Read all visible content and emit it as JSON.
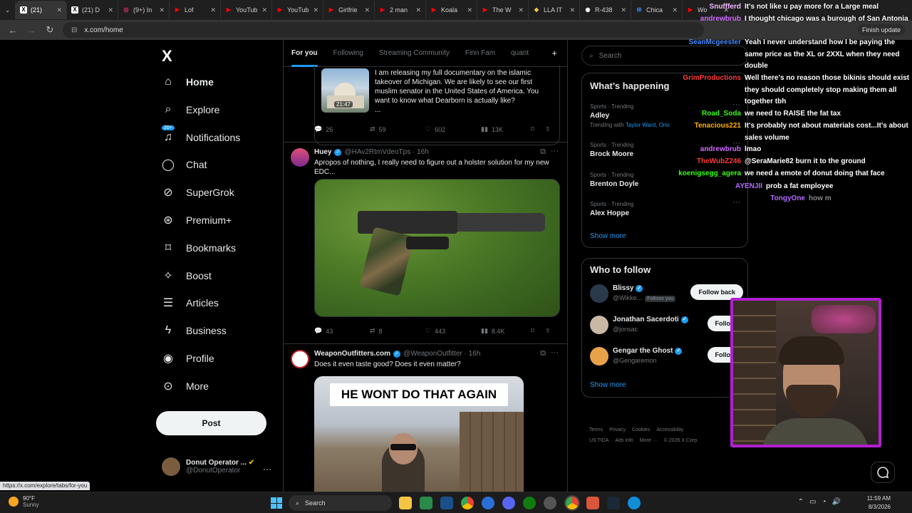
{
  "browser": {
    "tabs": [
      {
        "label": "(21)",
        "fav": "X",
        "color": "#000000",
        "active": true
      },
      {
        "label": "(21) D",
        "fav": "X",
        "color": "#000000"
      },
      {
        "label": "(9+) In",
        "fav": "◎",
        "color": "#e1306c"
      },
      {
        "label": "Lof",
        "fav": "▶",
        "color": "#ff0000"
      },
      {
        "label": "YouTub",
        "fav": "▶",
        "color": "#ff0000"
      },
      {
        "label": "YouTub",
        "fav": "▶",
        "color": "#ff0000"
      },
      {
        "label": "Girlfrie",
        "fav": "▶",
        "color": "#ff0000"
      },
      {
        "label": "2 man",
        "fav": "▶",
        "color": "#ff0000"
      },
      {
        "label": "Koala",
        "fav": "▶",
        "color": "#ff0000"
      },
      {
        "label": "The W",
        "fav": "▶",
        "color": "#ff0000"
      },
      {
        "label": "LLA IT",
        "fav": "◆",
        "color": "#f2c94c"
      },
      {
        "label": "R-438",
        "fav": "◉",
        "color": "#ffffff"
      },
      {
        "label": "Chica",
        "fav": "⊞",
        "color": "#3b82f6"
      },
      {
        "label": "Wo",
        "fav": "▶",
        "color": "#ff0000"
      }
    ],
    "url": "x.com/home",
    "finish_update": "Finish update",
    "status_url": "https://x.com/explore/tabs/for-you"
  },
  "nav": {
    "logo": "X",
    "items": [
      {
        "label": "Home",
        "icon": "home-icon"
      },
      {
        "label": "Explore",
        "icon": "search-icon"
      },
      {
        "label": "Notifications",
        "icon": "bell-icon"
      },
      {
        "label": "Chat",
        "icon": "chat-icon"
      },
      {
        "label": "SuperGrok",
        "icon": "grok-icon"
      },
      {
        "label": "Premium+",
        "icon": "premium-icon"
      },
      {
        "label": "Bookmarks",
        "icon": "bookmark-icon"
      },
      {
        "label": "Boost",
        "icon": "boost-icon"
      },
      {
        "label": "Articles",
        "icon": "articles-icon"
      },
      {
        "label": "Business",
        "icon": "lightning-icon"
      },
      {
        "label": "Profile",
        "icon": "person-icon"
      },
      {
        "label": "More",
        "icon": "more-circle-icon"
      }
    ],
    "notif_badge": "20+",
    "post_label": "Post",
    "account": {
      "name": "Donut Operator ...",
      "handle": "@DonutOperator"
    }
  },
  "timeline": {
    "tabs": [
      "For you",
      "Following",
      "Streaming Community",
      "Finn Fam",
      "quant"
    ],
    "quote": {
      "text": "I am releasing my full documentary on the islamic takeover of Michigan. We are likely to see our first muslim senator in the United States of America. You want to know what Dearborn is actually like?",
      "ellipsis": "...",
      "duration": "21:47"
    },
    "post1_actions": {
      "replies": "26",
      "reposts": "59",
      "likes": "602",
      "views": "13K"
    },
    "post2": {
      "name": "Huey",
      "handle": "@HAv2RtmVdeoTps · 16h",
      "text": "Apropos of nothing, I really need to figure out a holster solution for my new EDC...",
      "actions": {
        "replies": "43",
        "reposts": "8",
        "likes": "443",
        "views": "8.4K"
      }
    },
    "post3": {
      "name": "WeaponOutfitters.com",
      "handle": "@WeaponOutfitter · 16h",
      "text": "Does it even taste good? Does it even matter?",
      "meme_text": "HE WONT DO THAT AGAIN"
    }
  },
  "sidebar": {
    "search_placeholder": "Search",
    "happening_title": "What’s happening",
    "trends": [
      {
        "category": "Sports · Trending",
        "title": "Adley",
        "with_prefix": "Trending with",
        "with": "Taylor Ward, Orio"
      },
      {
        "category": "Sports · Trending",
        "title": "Brock Moore"
      },
      {
        "category": "Sports · Trending",
        "title": "Brenton Doyle"
      },
      {
        "category": "Sports · Trending",
        "title": "Alex Hoppe"
      }
    ],
    "show_more": "Show more",
    "who_to_follow_title": "Who to follow",
    "follows": [
      {
        "name": "Blissy",
        "handle": "@Wikke...",
        "follows_you": "Follows you",
        "button": "Follow back"
      },
      {
        "name": "Jonathan Sacerdoti",
        "handle": "@jonsac",
        "button": "Follow"
      },
      {
        "name": "Gengar the Ghost",
        "handle": "@Gengaremon",
        "button": "Follow"
      }
    ],
    "show_more_follow": "Show more",
    "footer": [
      "Terms",
      "Privacy",
      "Cookies",
      "Accessibility",
      "US TIDA",
      "Ads info",
      "More ···",
      "© 2026 X Corp."
    ]
  },
  "chat": [
    {
      "user": "Snuffferd",
      "color": "#f2b8ff",
      "msg": "It's not like u pay more for a Large meal"
    },
    {
      "user": "andrewbrub",
      "color": "#cf6cff",
      "msg": "I thought chicago was a burough of San Antonia"
    },
    {
      "user": "SeanMcgeester",
      "color": "#4a8bff",
      "msg": "Yeah I never understand how I be paying the same price as the XL or 2XXL when they need double"
    },
    {
      "user": "GrimProductions",
      "color": "#ff3b3b",
      "msg": "Well there's no reason those bikinis should exist they should completely stop making them all together tbh"
    },
    {
      "user": "Road_Soda",
      "color": "#39ff14",
      "msg": "we need to RAISE the fat tax"
    },
    {
      "user": "Tenacious221",
      "color": "#ffb000",
      "msg": "It's probably not about materials cost...It's about sales volume"
    },
    {
      "user": "andrewbrub",
      "color": "#cf6cff",
      "msg": "lmao"
    },
    {
      "user": "TheWubZ246",
      "color": "#ff3b3b",
      "msg": "@SeraMarie82 burn it to the ground"
    },
    {
      "user": "koenigsegg_agera",
      "color": "#39ff14",
      "msg": "we need a emote of donut doing that face"
    },
    {
      "user": "AYENJII",
      "color": "#b36bff",
      "msg": "prob a fat employee"
    },
    {
      "user": "TongyOne",
      "color": "#b36bff",
      "msg": "how m"
    }
  ],
  "taskbar": {
    "temp": "90°F",
    "weather": "Sunny",
    "search": "Search",
    "time": "11:59 AM",
    "date": "8/3/2026"
  }
}
